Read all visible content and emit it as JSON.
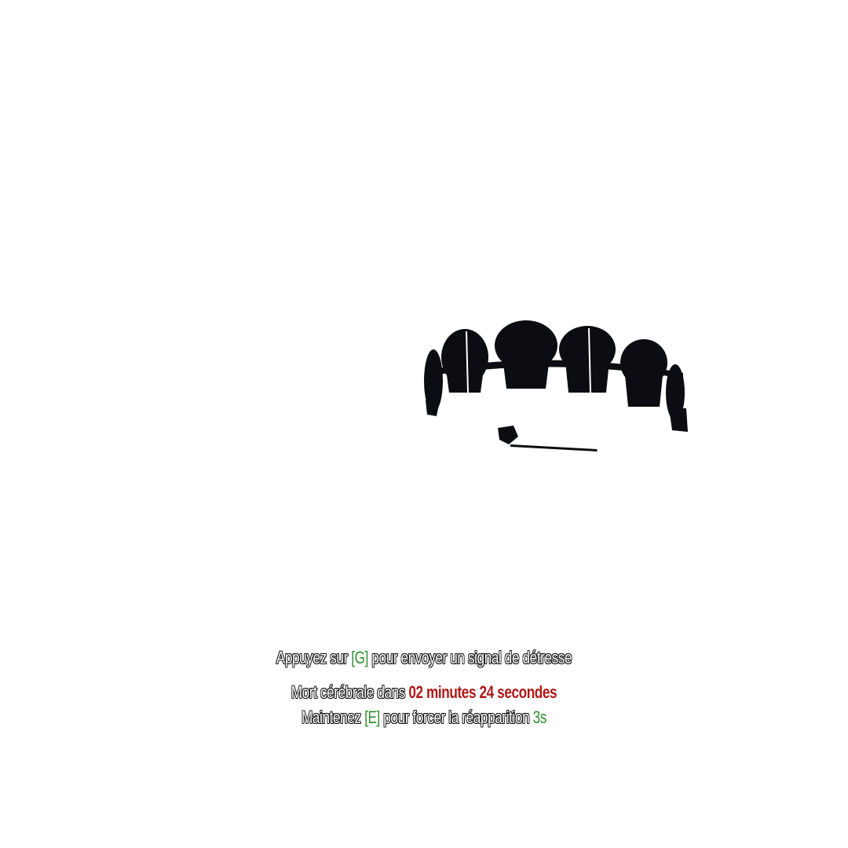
{
  "hud": {
    "distress": {
      "prefix": "Appuyez sur ",
      "key": "[G]",
      "suffix": " pour envoyer un signal de détresse"
    },
    "brain_death": {
      "prefix": "Mort cérébrale dans ",
      "timer": "02 minutes 24 secondes"
    },
    "respawn": {
      "prefix": "Maintenez ",
      "key": "[E]",
      "middle": " pour forcer la réapparition ",
      "countdown": "3s"
    }
  },
  "colors": {
    "key_highlight": "#2f8f2f",
    "timer_highlight": "#b01818",
    "object_fill": "#0b0d12",
    "background": "#ffffff"
  },
  "world": {
    "object": "skull-crown"
  }
}
